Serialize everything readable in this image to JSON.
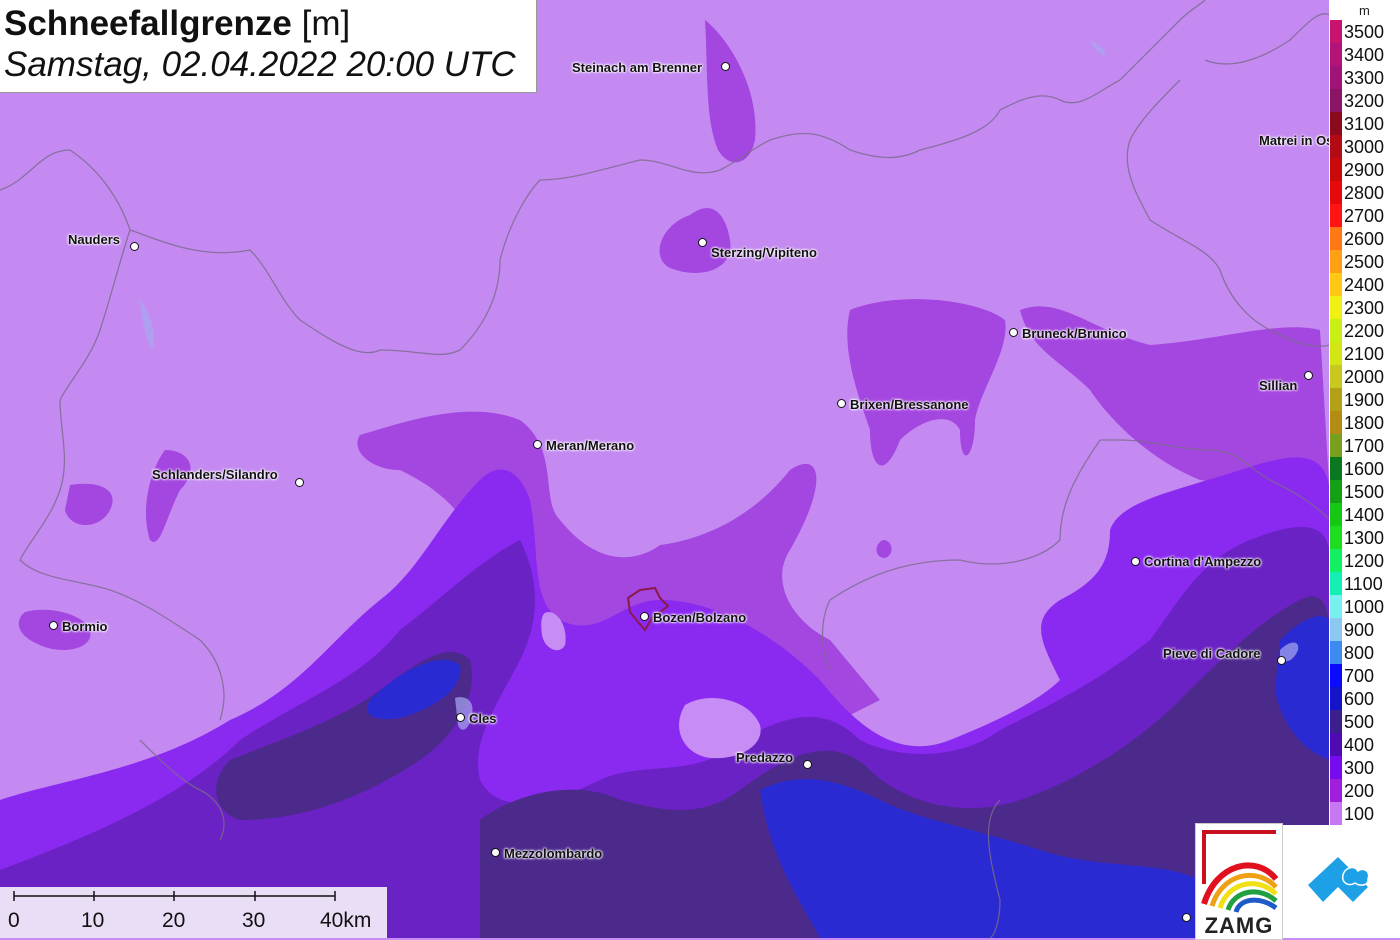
{
  "title": {
    "parameter": "Schneefallgrenze",
    "unit": "[m]",
    "datetime": "Samstag, 02.04.2022 20:00 UTC"
  },
  "cities": [
    {
      "name": "Steinach am Brenner"
    },
    {
      "name": "Matrei in Osttirol"
    },
    {
      "name": "Nauders"
    },
    {
      "name": "Sterzing/Vipiteno"
    },
    {
      "name": "Bruneck/Brunico"
    },
    {
      "name": "Sillian"
    },
    {
      "name": "Brixen/Bressanone"
    },
    {
      "name": "Meran/Merano"
    },
    {
      "name": "Schlanders/Silandro"
    },
    {
      "name": "Cortina d'Ampezzo"
    },
    {
      "name": "Bormio"
    },
    {
      "name": "Bozen/Bolzano"
    },
    {
      "name": "Pieve di Cadore"
    },
    {
      "name": "Cles"
    },
    {
      "name": "Predazzo"
    },
    {
      "name": "Mezzolombardo"
    }
  ],
  "legend": {
    "unit": "m",
    "entries": [
      {
        "label": "3500",
        "color": "#c8146e"
      },
      {
        "label": "3400",
        "color": "#b41478"
      },
      {
        "label": "3300",
        "color": "#a01478"
      },
      {
        "label": "3200",
        "color": "#8c1464"
      },
      {
        "label": "3100",
        "color": "#8c0a1e"
      },
      {
        "label": "3000",
        "color": "#b40a14"
      },
      {
        "label": "2900",
        "color": "#c80a0a"
      },
      {
        "label": "2800",
        "color": "#e60a0a"
      },
      {
        "label": "2700",
        "color": "#ff1414"
      },
      {
        "label": "2600",
        "color": "#ff7814"
      },
      {
        "label": "2500",
        "color": "#ffa014"
      },
      {
        "label": "2400",
        "color": "#ffc814"
      },
      {
        "label": "2300",
        "color": "#f0f014"
      },
      {
        "label": "2200",
        "color": "#c8f014"
      },
      {
        "label": "2100",
        "color": "#d2e614"
      },
      {
        "label": "2000",
        "color": "#c8c81e"
      },
      {
        "label": "1900",
        "color": "#b4a014"
      },
      {
        "label": "1800",
        "color": "#b48c14"
      },
      {
        "label": "1700",
        "color": "#78a01e"
      },
      {
        "label": "1600",
        "color": "#0a781e"
      },
      {
        "label": "1500",
        "color": "#14a014"
      },
      {
        "label": "1400",
        "color": "#14c814"
      },
      {
        "label": "1300",
        "color": "#1edc1e"
      },
      {
        "label": "1200",
        "color": "#14f064"
      },
      {
        "label": "1100",
        "color": "#14f0b4"
      },
      {
        "label": "1000",
        "color": "#78f0f0"
      },
      {
        "label": "900",
        "color": "#8cc8f0"
      },
      {
        "label": "800",
        "color": "#3c8cf0"
      },
      {
        "label": "700",
        "color": "#0a0aff"
      },
      {
        "label": "600",
        "color": "#1414c8"
      },
      {
        "label": "500",
        "color": "#3c1e8c"
      },
      {
        "label": "400",
        "color": "#500ab4"
      },
      {
        "label": "300",
        "color": "#780af0"
      },
      {
        "label": "200",
        "color": "#a01edc"
      },
      {
        "label": "100",
        "color": "#c878f0"
      }
    ]
  },
  "scalebar": {
    "labels": [
      "0",
      "10",
      "20",
      "30",
      "40km"
    ]
  },
  "logos": {
    "zamg": "ZAMG",
    "geosphere_icon": "geosphere-logo-icon"
  },
  "colors": {
    "base_fill": "#c88cf5",
    "fill_200": "#a01edc",
    "fill_300": "#8a28f0",
    "fill_400": "#6a1ec8",
    "fill_500": "#4a2a8c",
    "fill_600": "#2a2ad2"
  }
}
